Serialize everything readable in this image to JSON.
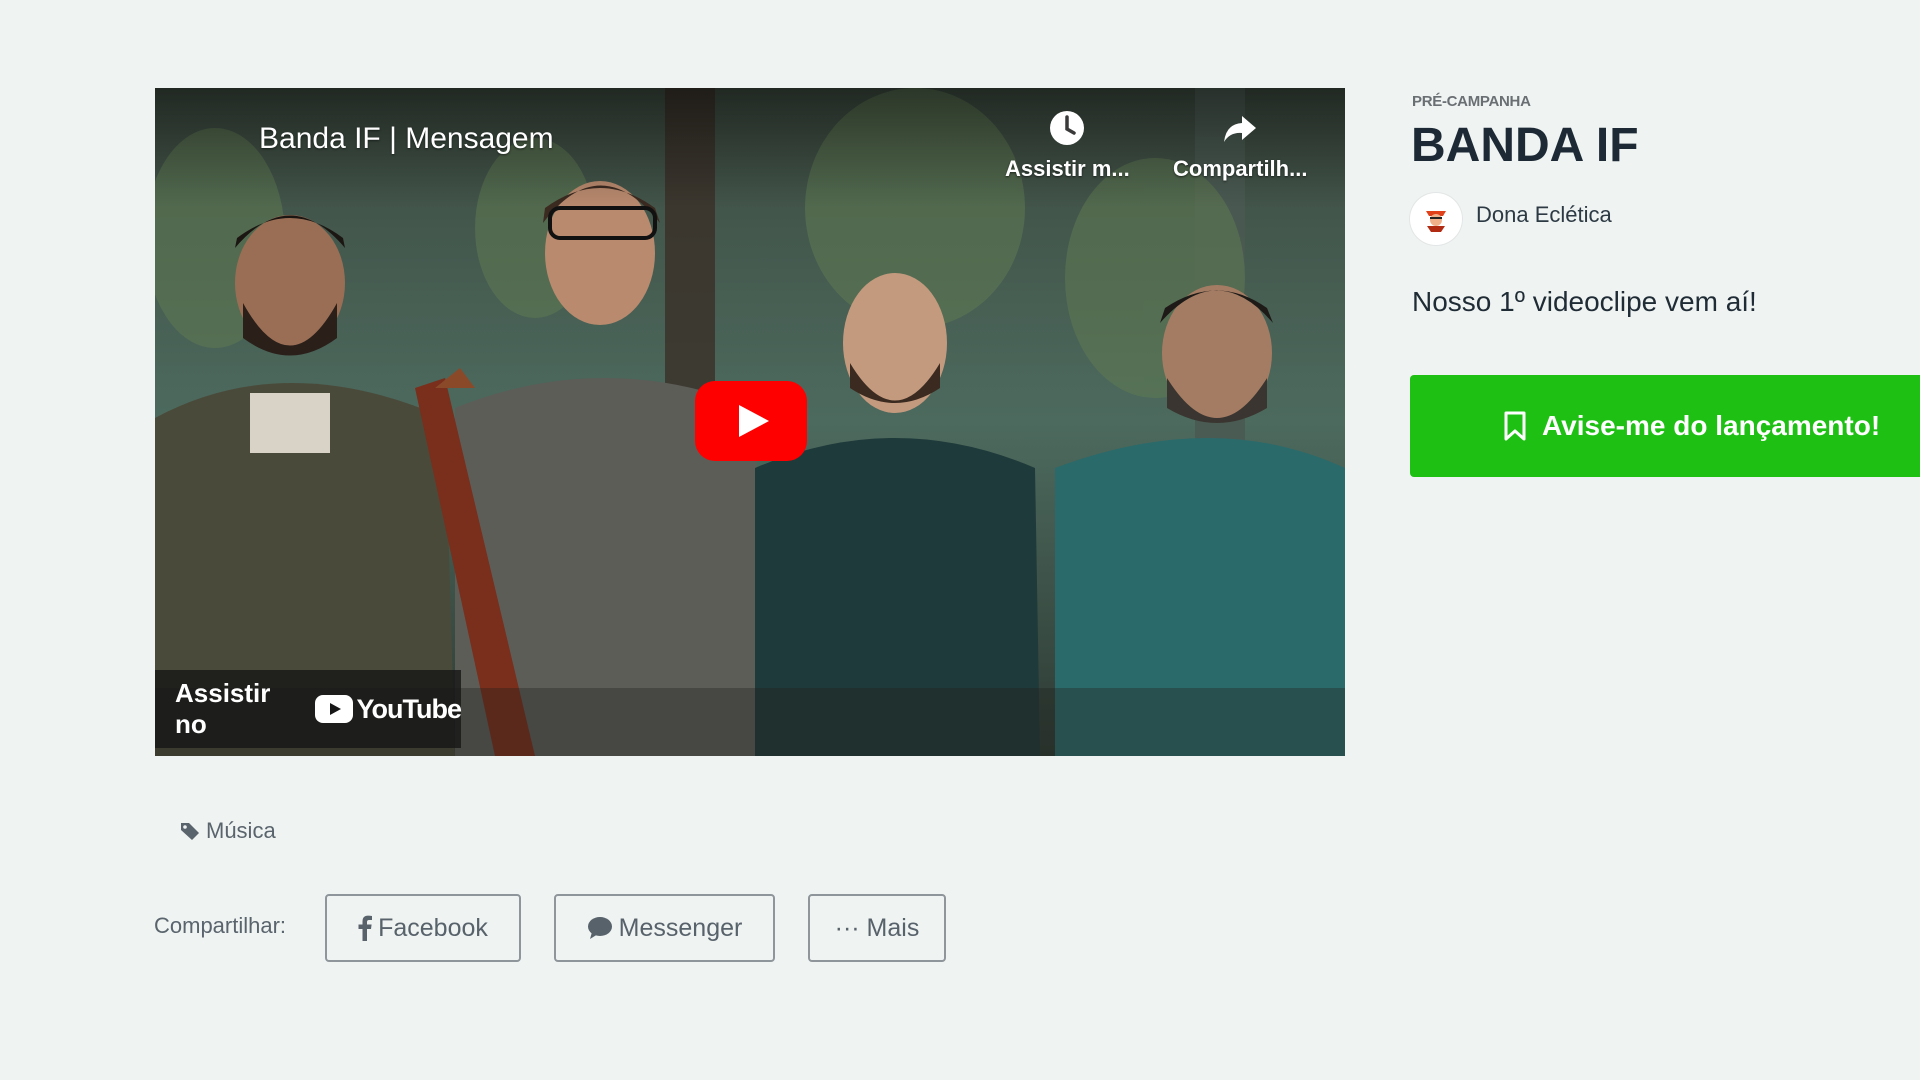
{
  "video": {
    "title": "Banda IF | Mensagem",
    "watch_later_label": "Assistir m...",
    "share_label": "Compartilh...",
    "watch_on_label": "Assistir no",
    "youtube_wordmark": "YouTube",
    "play_color": "#ff0000"
  },
  "campaign": {
    "status": "PRÉ-CAMPANHA",
    "title": "BANDA IF",
    "creator": "Dona Eclética",
    "headline": "Nosso 1º videoclipe vem aí!",
    "notify_button": "Avise-me do lançamento!",
    "accent_color": "#1ec014"
  },
  "category": {
    "label": "Música"
  },
  "share": {
    "label": "Compartilhar:",
    "facebook": "Facebook",
    "messenger": "Messenger",
    "more": "··· Mais"
  }
}
